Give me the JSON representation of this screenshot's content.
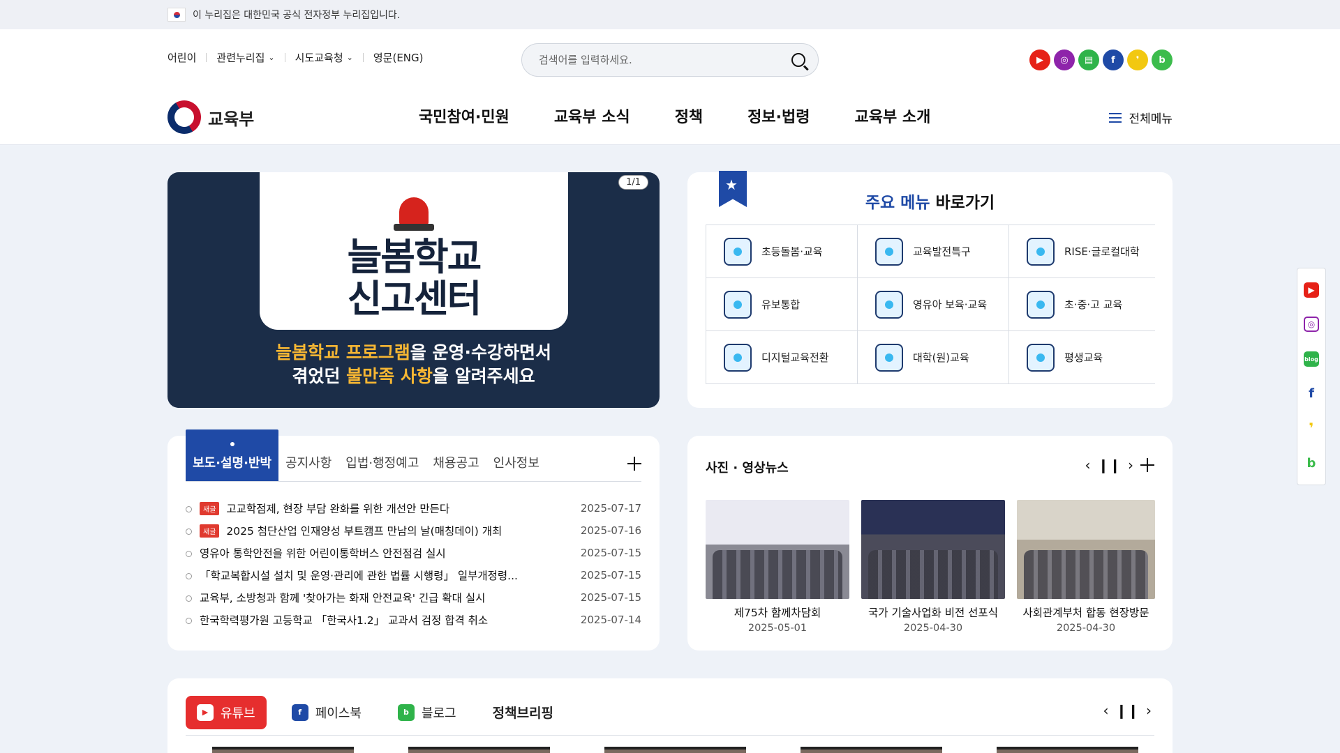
{
  "govbar": {
    "text": "이 누리집은 대한민국 공식 전자정부 누리집입니다."
  },
  "util": {
    "kids": "어린이",
    "related": "관련누리집",
    "offices": "시도교육청",
    "english": "영문(ENG)"
  },
  "search": {
    "placeholder": "검색어를 입력하세요."
  },
  "sns_icons": [
    {
      "name": "youtube-icon",
      "color": "#e62117"
    },
    {
      "name": "instagram-icon",
      "color": "#8e24aa"
    },
    {
      "name": "talk-icon",
      "color": "#2fb34a"
    },
    {
      "name": "facebook-icon",
      "color": "#1f4aa6"
    },
    {
      "name": "kakao-icon",
      "color": "#f2c811"
    },
    {
      "name": "band-icon",
      "color": "#3cbc4c"
    }
  ],
  "logo": {
    "text": "교육부"
  },
  "gnb": [
    "국민참여·민원",
    "교육부 소식",
    "정책",
    "정보·법령",
    "교육부 소개"
  ],
  "allmenu": "전체메뉴",
  "banner": {
    "pager": "1/1",
    "title_line1": "늘봄학교",
    "title_line2": "신고센터",
    "sub1_hl": "늘봄학교 프로그램",
    "sub1_rest": "을 운영·수강하면서",
    "sub2_a": "겪었던 ",
    "sub2_hl": "불만족 사항",
    "sub2_b": "을 알려주세요"
  },
  "quick": {
    "title_hl": "주요 메뉴",
    "title_rest": " 바로가기",
    "items": [
      "초등돌봄·교육",
      "교육발전특구",
      "RISE·글로컬대학",
      "유보통합",
      "영유아 보육·교육",
      "초·중·고 교육",
      "디지털교육전환",
      "대학(원)교육",
      "평생교육"
    ]
  },
  "board": {
    "tabs": [
      "보도·설명·반박",
      "공지사항",
      "입법·행정예고",
      "채용공고",
      "인사정보"
    ],
    "new_label": "새글",
    "items": [
      {
        "title": "고교학점제, 현장 부담 완화를 위한 개선안 만든다",
        "date": "2025-07-17",
        "new": true
      },
      {
        "title": "2025 첨단산업 인재양성 부트캠프 만남의 날(매칭데이) 개최",
        "date": "2025-07-16",
        "new": true
      },
      {
        "title": "영유아 통학안전을 위한 어린이통학버스 안전점검 실시",
        "date": "2025-07-15",
        "new": false
      },
      {
        "title": "「학교복합시설 설치 및 운영·관리에 관한 법률 시행령」 일부개정령...",
        "date": "2025-07-15",
        "new": false
      },
      {
        "title": "교육부, 소방청과 함께 '찾아가는 화재 안전교육' 긴급 확대 실시",
        "date": "2025-07-15",
        "new": false
      },
      {
        "title": "한국학력평가원 고등학교 「한국사1.2」 교과서 검정 합격 취소",
        "date": "2025-07-14",
        "new": false
      }
    ]
  },
  "photo": {
    "title": "사진 · 영상뉴스",
    "items": [
      {
        "caption": "제75차 함께차담회",
        "date": "2025-05-01"
      },
      {
        "caption": "국가 기술사업화 비전 선포식",
        "date": "2025-04-30"
      },
      {
        "caption": "사회관계부처 합동 현장방문",
        "date": "2025-04-30"
      }
    ]
  },
  "sns_tabs": [
    {
      "label": "유튜브",
      "color": "#e62e2e"
    },
    {
      "label": "페이스북",
      "color": "#1f4aa6"
    },
    {
      "label": "블로그",
      "color": "#2fb34a"
    },
    {
      "label": "정책브리핑",
      "color": "#111111"
    }
  ]
}
